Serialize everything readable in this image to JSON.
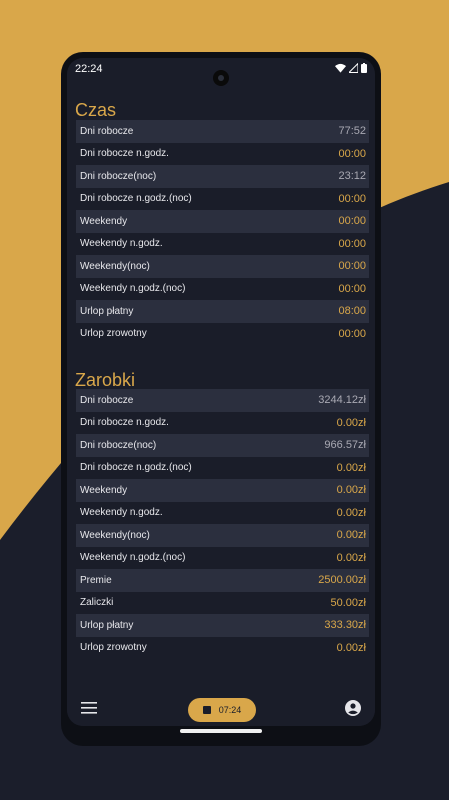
{
  "status": {
    "time": "22:24"
  },
  "sections": {
    "czas": {
      "title": "Czas",
      "rows": [
        {
          "label": "Dni robocze",
          "value": "77:52"
        },
        {
          "label": "Dni robocze n.godz.",
          "value": "00:00"
        },
        {
          "label": "Dni robocze(noc)",
          "value": "23:12"
        },
        {
          "label": "Dni robocze n.godz.(noc)",
          "value": "00:00"
        },
        {
          "label": "Weekendy",
          "value": "00:00"
        },
        {
          "label": "Weekendy n.godz.",
          "value": "00:00"
        },
        {
          "label": "Weekendy(noc)",
          "value": "00:00"
        },
        {
          "label": "Weekendy n.godz.(noc)",
          "value": "00:00"
        },
        {
          "label": "Urlop płatny",
          "value": "08:00"
        },
        {
          "label": "Urlop zrowotny",
          "value": "00:00"
        }
      ]
    },
    "zarobki": {
      "title": "Zarobki",
      "rows": [
        {
          "label": "Dni robocze",
          "value": "3244.12zł"
        },
        {
          "label": "Dni robocze n.godz.",
          "value": "0.00zł"
        },
        {
          "label": "Dni robocze(noc)",
          "value": "966.57zł"
        },
        {
          "label": "Dni robocze n.godz.(noc)",
          "value": "0.00zł"
        },
        {
          "label": "Weekendy",
          "value": "0.00zł"
        },
        {
          "label": "Weekendy n.godz.",
          "value": "0.00zł"
        },
        {
          "label": "Weekendy(noc)",
          "value": "0.00zł"
        },
        {
          "label": "Weekendy n.godz.(noc)",
          "value": "0.00zł"
        },
        {
          "label": "Premie",
          "value": "2500.00zł"
        },
        {
          "label": "Zaliczki",
          "value": "50.00zł"
        },
        {
          "label": "Urlop płatny",
          "value": "333.30zł"
        },
        {
          "label": "Urlop zrowotny",
          "value": "0.00zł"
        }
      ]
    }
  },
  "bottom": {
    "timer": "07:24"
  },
  "icons": {
    "menu": "menu-icon",
    "stop": "stop-icon",
    "account": "account-circle-icon"
  },
  "colors": {
    "accent": "#d9a74a",
    "background": "#1a1d29",
    "row_alt": "#2b2f3e"
  }
}
